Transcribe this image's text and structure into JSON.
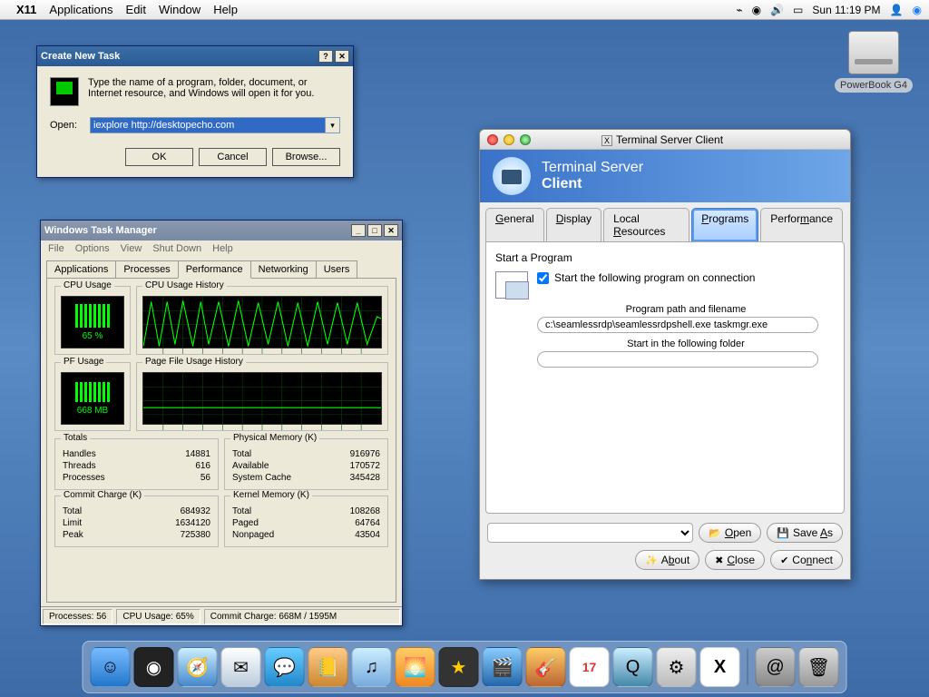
{
  "menubar": {
    "app": "X11",
    "items": [
      "Applications",
      "Edit",
      "Window",
      "Help"
    ],
    "clock": "Sun 11:19 PM"
  },
  "desktop_icon": {
    "label": "PowerBook G4"
  },
  "create_task": {
    "title": "Create New Task",
    "desc": "Type the name of a program, folder, document, or Internet resource, and Windows will open it for you.",
    "open_label": "Open:",
    "open_value": "iexplore http://desktopecho.com",
    "ok": "OK",
    "cancel": "Cancel",
    "browse": "Browse..."
  },
  "task_manager": {
    "title": "Windows Task Manager",
    "menu": [
      "File",
      "Options",
      "View",
      "Shut Down",
      "Help"
    ],
    "tabs": [
      "Applications",
      "Processes",
      "Performance",
      "Networking",
      "Users"
    ],
    "active_tab": "Performance",
    "cpu_usage_label": "CPU Usage",
    "cpu_history_label": "CPU Usage History",
    "pf_usage_label": "PF Usage",
    "pf_history_label": "Page File Usage History",
    "cpu_value": "65 %",
    "pf_value": "668 MB",
    "totals": {
      "title": "Totals",
      "rows": [
        [
          "Handles",
          "14881"
        ],
        [
          "Threads",
          "616"
        ],
        [
          "Processes",
          "56"
        ]
      ]
    },
    "physmem": {
      "title": "Physical Memory (K)",
      "rows": [
        [
          "Total",
          "916976"
        ],
        [
          "Available",
          "170572"
        ],
        [
          "System Cache",
          "345428"
        ]
      ]
    },
    "commit": {
      "title": "Commit Charge (K)",
      "rows": [
        [
          "Total",
          "684932"
        ],
        [
          "Limit",
          "1634120"
        ],
        [
          "Peak",
          "725380"
        ]
      ]
    },
    "kernel": {
      "title": "Kernel Memory (K)",
      "rows": [
        [
          "Total",
          "108268"
        ],
        [
          "Paged",
          "64764"
        ],
        [
          "Nonpaged",
          "43504"
        ]
      ]
    },
    "status": {
      "procs": "Processes: 56",
      "cpu": "CPU Usage: 65%",
      "commit": "Commit Charge: 668M / 1595M"
    }
  },
  "ts_client": {
    "window_title": "Terminal Server Client",
    "banner_line1": "Terminal Server",
    "banner_line2": "Client",
    "tabs": [
      "General",
      "Display",
      "Local Resources",
      "Programs",
      "Performance"
    ],
    "active_tab": "Programs",
    "section_title": "Start a Program",
    "checkbox_label": "Start the following program on connection",
    "checked": true,
    "path_label": "Program path and filename",
    "path_value": "c:\\seamlessrdp\\seamlessrdpshell.exe taskmgr.exe",
    "folder_label": "Start in the following folder",
    "folder_value": "",
    "open_btn": "Open",
    "saveas_btn": "Save As",
    "about_btn": "About",
    "close_btn": "Close",
    "connect_btn": "Connect"
  },
  "dock_icons": [
    "finder",
    "dashboard",
    "safari",
    "mail",
    "ichat",
    "address",
    "itunes",
    "iphoto",
    "imovie",
    "idvd",
    "garage",
    "ical",
    "quicktime",
    "sysprefs",
    "x11",
    "sherlock",
    "trash"
  ]
}
